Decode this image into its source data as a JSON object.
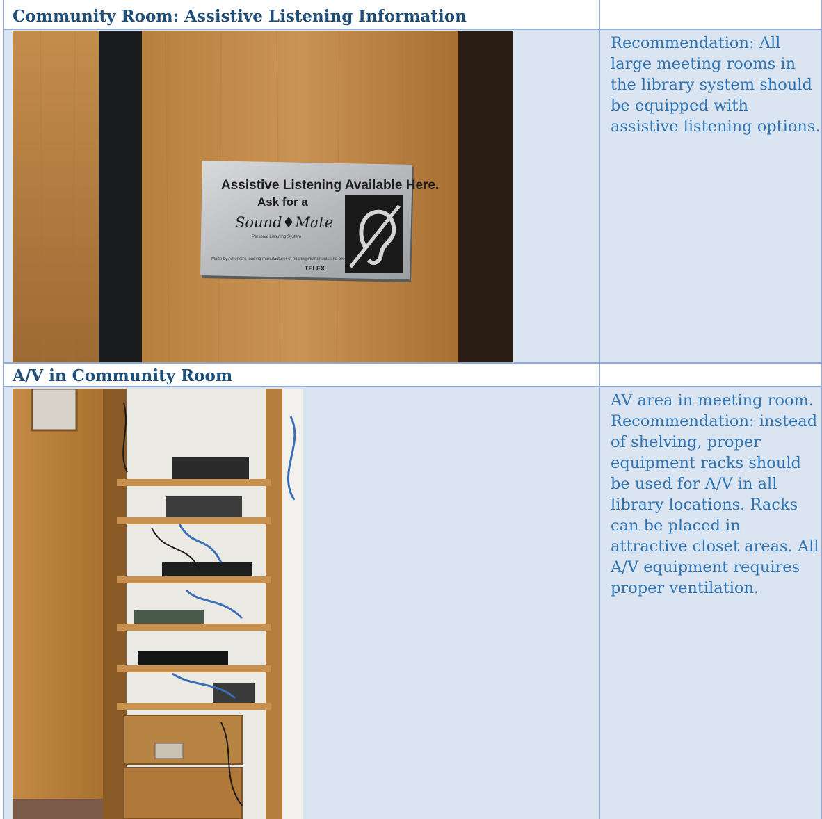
{
  "sections": [
    {
      "heading": "Community Room: Assistive Listening Information",
      "note": "Recommendation:  All large meeting rooms in the library system should be equipped with assistive listening options.",
      "photo": {
        "alt": "Door-mounted assistive listening plaque",
        "sign": {
          "line1": "Assistive Listening Available Here.",
          "line2": "Ask for a",
          "brand": "Sound♦Mate",
          "tag": "Personal Listening System",
          "footer": "Made by America's leading manufacturer of hearing instruments and professional audio products.",
          "maker": "TELEX"
        }
      }
    },
    {
      "heading": "A/V in Community Room",
      "note": "AV area in meeting room.\nRecommendation: instead of shelving, proper equipment racks should be used for A/V in all library locations.   Racks can be placed in attractive closet areas.  All A/V equipment requires proper ventilation.",
      "photo": {
        "alt": "Wooden shelving unit holding A/V equipment"
      }
    }
  ],
  "colors": {
    "heading": "#1f4e79",
    "note": "#2e74b5",
    "cell_fill": "#dbe5f1",
    "border": "#8eaadb"
  }
}
